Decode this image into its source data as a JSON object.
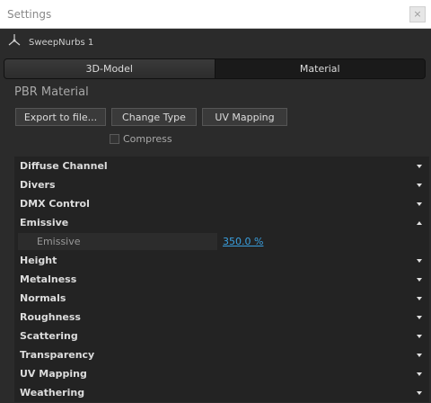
{
  "window": {
    "title": "Settings",
    "close_glyph": "×"
  },
  "object": {
    "name": "SweepNurbs 1",
    "icon": "sweep-nurbs-icon"
  },
  "tabs": [
    {
      "label": "3D-Model"
    },
    {
      "label": "Material"
    }
  ],
  "material": {
    "section_title": "PBR Material",
    "buttons": {
      "export": "Export to file...",
      "change_type": "Change Type",
      "uv_mapping": "UV Mapping"
    },
    "compress_label": "Compress",
    "compress_checked": false
  },
  "channels": [
    {
      "label": "Diffuse Channel",
      "expanded": false
    },
    {
      "label": "Divers",
      "expanded": false
    },
    {
      "label": "DMX Control",
      "expanded": false
    },
    {
      "label": "Emissive",
      "expanded": true
    },
    {
      "label": "Height",
      "expanded": false
    },
    {
      "label": "Metalness",
      "expanded": false
    },
    {
      "label": "Normals",
      "expanded": false
    },
    {
      "label": "Roughness",
      "expanded": false
    },
    {
      "label": "Scattering",
      "expanded": false
    },
    {
      "label": "Transparency",
      "expanded": false
    },
    {
      "label": "UV Mapping",
      "expanded": false
    },
    {
      "label": "Weathering",
      "expanded": false
    }
  ],
  "emissive": {
    "param_label": "Emissive",
    "value": "350.0 %"
  },
  "colors": {
    "background": "#2b2b2b",
    "list_background": "#232323",
    "link": "#3aa0e0"
  }
}
